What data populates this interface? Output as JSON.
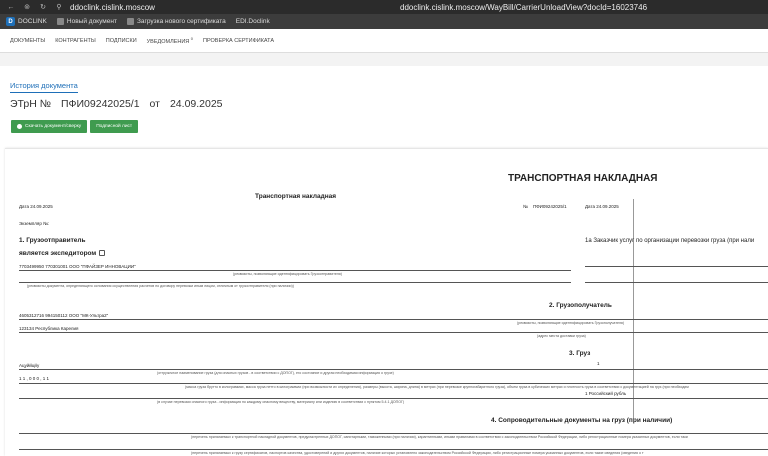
{
  "browser": {
    "url_left": "ddoclink.cislink.moscow",
    "url_center": "ddoclink.cislink.moscow/WayBill/CarrierUnloadView?docId=16023746"
  },
  "bookmarks": [
    {
      "label": "DOCLINK"
    },
    {
      "label": "Новый документ"
    },
    {
      "label": "Загрузка нового сертификата"
    },
    {
      "label": "EDI.Doclink"
    }
  ],
  "menu": {
    "items": [
      "Документы",
      "Контрагенты",
      "Подписки",
      "Уведомления",
      "Проверка сертификата"
    ],
    "badge": "0"
  },
  "page": {
    "history": "История документа",
    "doc_type": "ЭТрН №",
    "doc_num": "ПФИ09242025/1",
    "from": "от",
    "date": "24.09.2025",
    "btn_download": "Скачать документ/сверку",
    "btn_sheet": "Подписной лист"
  },
  "doc": {
    "main_title": "ТРАНСПОРТНАЯ НАКЛАДНАЯ",
    "sub_title": "Транспортная накладная",
    "date_left": "Дата 24.09.2025",
    "num_label": "№",
    "num_value": "ПФИ09242025/1",
    "date_right": "Дата 24.09.2025",
    "copy": "Экземпляр №:",
    "s1": "1. Грузоотправитель",
    "forwarder": "является экспедитором",
    "shipper": "7703499950 770301001 ООО \"ПФАЙЗЕР ИННОВАЦИИ\"",
    "cap1": "(реквизиты, позволяющие идентифицировать Грузоотправителя)",
    "cap2": "(реквизиты документа, определяющего основания осуществления расчетов по договору перевозки иным лицом, отличным от грузоотправителя (при наличии))",
    "s1a": "1а Заказчик услуг по организации перевозки груза (при нали",
    "s2": "2. Грузополучатель",
    "consignee": "4605312716 994150112 ООО \"МК-Ультра2\"",
    "cap3": "(реквизиты, позволяющие идентифицировать Грузополучателя)",
    "address": "123134 Республика Карелия",
    "cap4": "(адрес места доставки груза)",
    "s3": "3. Груз",
    "cargo_qty": "1",
    "cargo_name": "Ацуййцйу",
    "cap5": "(отгрузочное наименование груза (для опасных грузов - в соответствии с ДОПОГ), его состояние и другая необходимая информация о грузе)",
    "weight": "1 1 , 0 0 0 , 1 1",
    "cap6": "(масса груза брутто в килограммах, масса груза нетто в килограммах (при возможности их определения), размеры (высота, ширина, длина) в метрах (при перевозке крупногабаритного груза), объем груза в кубических метрах и плотность груза в соответствии с документацией на груз (при необходим",
    "currency": "1 Российский рубль",
    "cap7": "(в случае перевозки опасного груза - информация по каждому опасному веществу, материалу или изделию в соответствии с пунктом 5.4.1 ДОПОГ)",
    "s4": "4. Сопроводительные документы на груз (при наличии)",
    "cap8": "(перечень прилагаемых к транспортной накладной документов, предусмотренных ДОПОГ, санитарными, таможенными (при наличии), карантинными, иными правилами в соответствии с законодательством Российской Федерации, либо регистрационные номера указанных документов, если таки",
    "cap9": "(перечень прилагаемых к грузу сертификатов, паспортов качества, удостоверений и других документов, наличие которых установлено законодательством Российской Федерации, либо регистрационные номера указанных документов, если такие сведения (сведения о т"
  }
}
